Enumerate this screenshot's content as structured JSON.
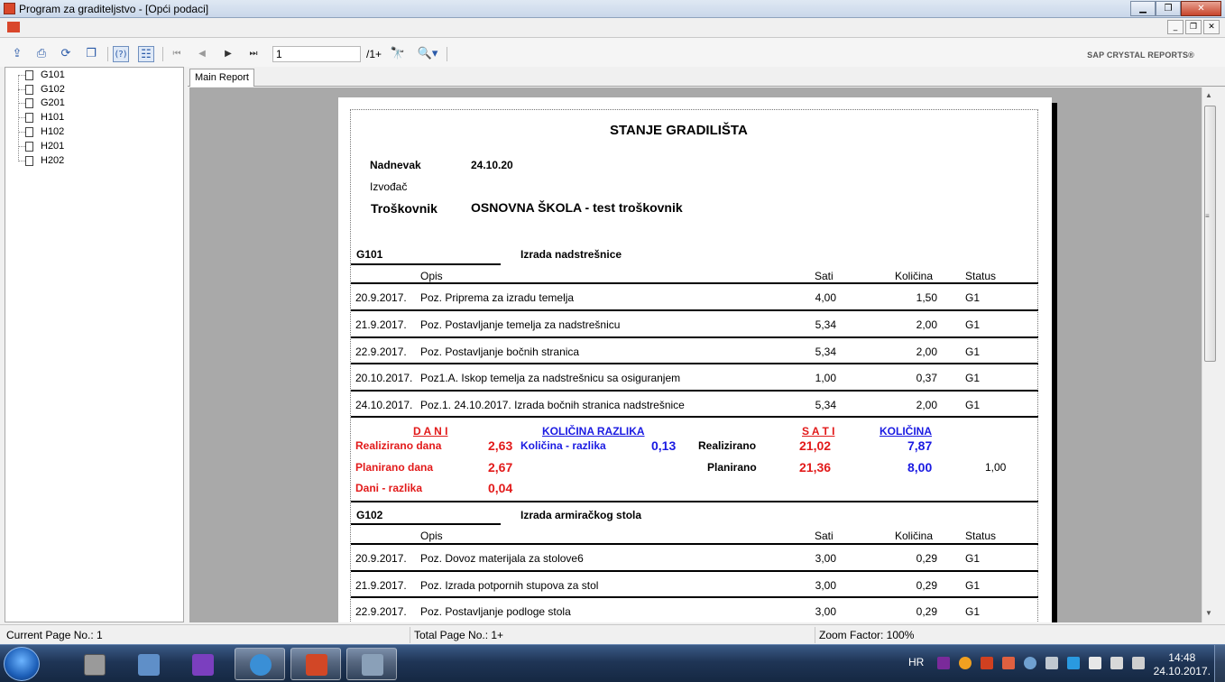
{
  "window": {
    "title": "Program za graditeljstvo - [Opći podaci]"
  },
  "toolbar": {
    "page_value": "1",
    "page_total": "/1+",
    "brand": "SAP CRYSTAL REPORTS®"
  },
  "tree": {
    "items": [
      "G101",
      "G102",
      "G201",
      "H101",
      "H102",
      "H201",
      "H202"
    ]
  },
  "tabs": {
    "main": "Main Report"
  },
  "report": {
    "title": "STANJE GRADILIŠTA",
    "nadnevak_label": "Nadnevak",
    "nadnevak_value": "24.10.20",
    "izvodjac_label": "Izvođač",
    "troskovnik_label": "Troškovnik",
    "troskovnik_value": "OSNOVNA ŠKOLA - test troškovnik",
    "col_opis": "Opis",
    "col_sati": "Sati",
    "col_kolicina": "Količina",
    "col_status": "Status",
    "groups": [
      {
        "code": "G101",
        "name": "Izrada nadstrešnice",
        "rows": [
          {
            "date": "20.9.2017.",
            "desc": "Poz. Priprema za izradu temelja",
            "sati": "4,00",
            "kolicina": "1,50",
            "status": "G1"
          },
          {
            "date": "21.9.2017.",
            "desc": "Poz. Postavljanje temelja za nadstrešnicu",
            "sati": "5,34",
            "kolicina": "2,00",
            "status": "G1"
          },
          {
            "date": "22.9.2017.",
            "desc": "Poz. Postavljanje bočnih stranica",
            "sati": "5,34",
            "kolicina": "2,00",
            "status": "G1"
          },
          {
            "date": "20.10.2017.",
            "desc": "Poz1.A. Iskop temelja za nadstrešnicu sa osiguranjem",
            "sati": "1,00",
            "kolicina": "0,37",
            "status": "G1"
          },
          {
            "date": "24.10.2017.",
            "desc": "Poz.1. 24.10.2017.  Izrada bočnih stranica nadstrešnice",
            "sati": "5,34",
            "kolicina": "2,00",
            "status": "G1"
          }
        ],
        "summary": {
          "dani_header": "D A N I",
          "kol_razlika_header": "KOLIČINA RAZLIKA",
          "sati_header": "S A T I",
          "kolicina_header": "KOLIČINA",
          "realizirano_dana_label": "Realizirano dana",
          "realizirano_dana": "2,63",
          "kolicina_razlika_label": "Količina - razlika",
          "kolicina_razlika": "0,13",
          "realizirano_label": "Realizirano",
          "realizirano_sati": "21,02",
          "realizirano_kol": "7,87",
          "planirano_dana_label": "Planirano dana",
          "planirano_dana": "2,67",
          "planirano_label": "Planirano",
          "planirano_sati": "21,36",
          "planirano_kol": "8,00",
          "extra": "1,00",
          "dani_razlika_label": "Dani - razlika",
          "dani_razlika": "0,04"
        }
      },
      {
        "code": "G102",
        "name": "Izrada armiračkog stola",
        "rows": [
          {
            "date": "20.9.2017.",
            "desc": "Poz. Dovoz materijala za stolove6",
            "sati": "3,00",
            "kolicina": "0,29",
            "status": "G1"
          },
          {
            "date": "21.9.2017.",
            "desc": "Poz. Izrada potpornih stupova za stol",
            "sati": "3,00",
            "kolicina": "0,29",
            "status": "G1"
          },
          {
            "date": "22.9.2017.",
            "desc": "Poz. Postavljanje podloge stola",
            "sati": "3,00",
            "kolicina": "0,29",
            "status": "G1"
          }
        ]
      }
    ]
  },
  "statusbar": {
    "current": "Current Page No.: 1",
    "total": "Total Page No.: 1+",
    "zoom": "Zoom Factor: 100%"
  },
  "taskbar": {
    "lang": "HR",
    "time": "14:48",
    "date": "24.10.2017."
  }
}
